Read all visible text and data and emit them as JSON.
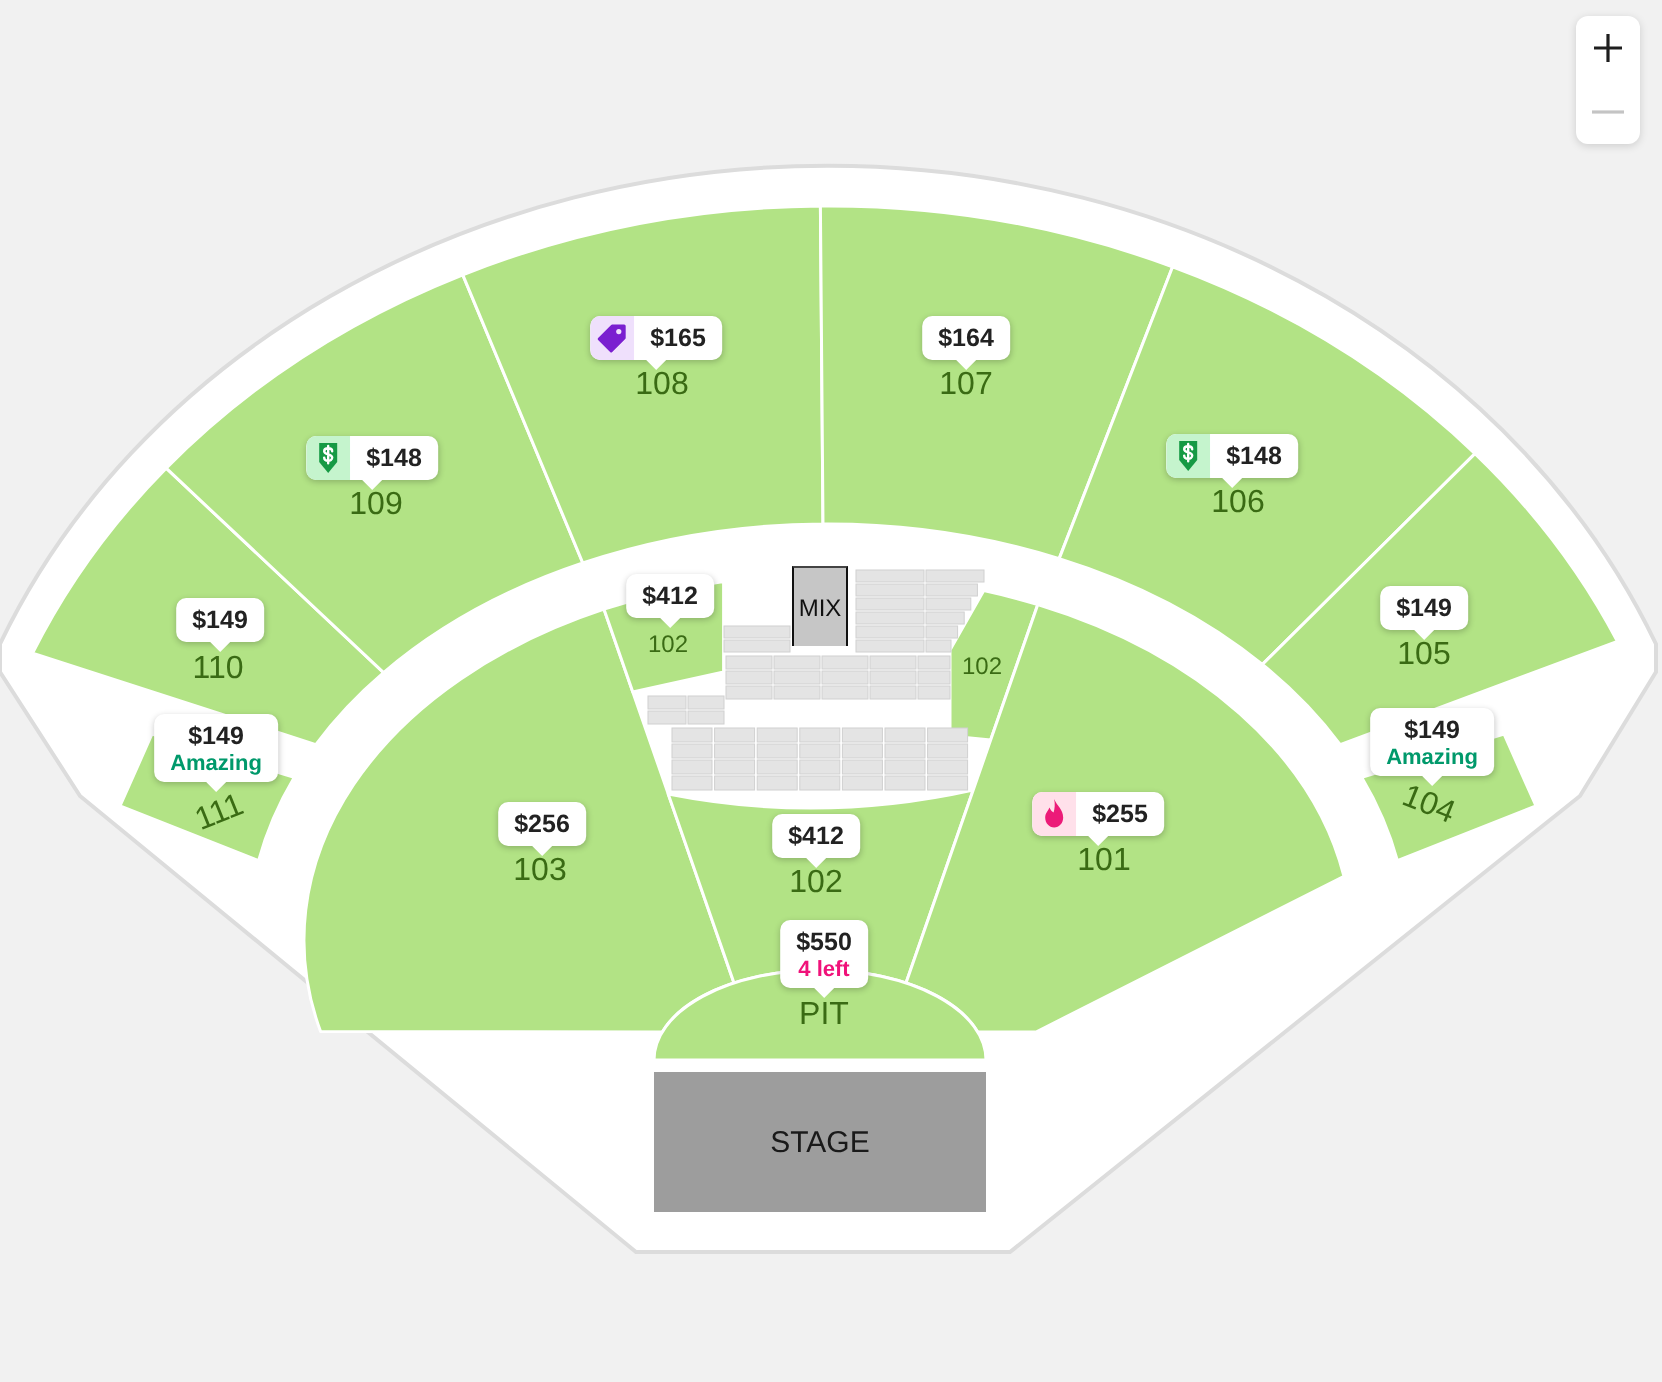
{
  "zoom_controls": [
    {
      "kind": "zoom_in",
      "disabled": false
    },
    {
      "kind": "zoom_out",
      "disabled": true
    }
  ],
  "sections": [
    {
      "label": "111",
      "pin": {
        "price": "$149",
        "kind": "plain",
        "note": {
          "text": "Amazing",
          "color": "#00996b"
        }
      }
    },
    {
      "label": "110",
      "pin": {
        "price": "$149",
        "kind": "plain"
      }
    },
    {
      "label": "109",
      "pin": {
        "price": "$148",
        "kind": "deal"
      }
    },
    {
      "label": "108",
      "pin": {
        "price": "$165",
        "kind": "tag"
      }
    },
    {
      "label": "107",
      "pin": {
        "price": "$164",
        "kind": "plain"
      }
    },
    {
      "label": "106",
      "pin": {
        "price": "$148",
        "kind": "deal"
      }
    },
    {
      "label": "105",
      "pin": {
        "price": "$149",
        "kind": "plain"
      }
    },
    {
      "label": "104",
      "pin": {
        "price": "$149",
        "kind": "plain",
        "note": {
          "text": "Amazing",
          "color": "#00996b"
        }
      }
    },
    {
      "label": "103",
      "pin": {
        "price": "$256",
        "kind": "plain"
      }
    },
    {
      "label": "102",
      "pin": {
        "price": "$412",
        "kind": "plain"
      }
    },
    {
      "label": "102",
      "pin": {
        "price": "$412",
        "kind": "plain"
      }
    },
    {
      "label": "102"
    },
    {
      "label": "101",
      "pin": {
        "price": "$255",
        "kind": "hot"
      }
    },
    {
      "label": "PIT",
      "pin": {
        "price": "$550",
        "kind": "plain",
        "note": {
          "text": "4 left",
          "color": "#f0127a"
        }
      }
    }
  ],
  "mix": "MIX",
  "stage": "STAGE"
}
